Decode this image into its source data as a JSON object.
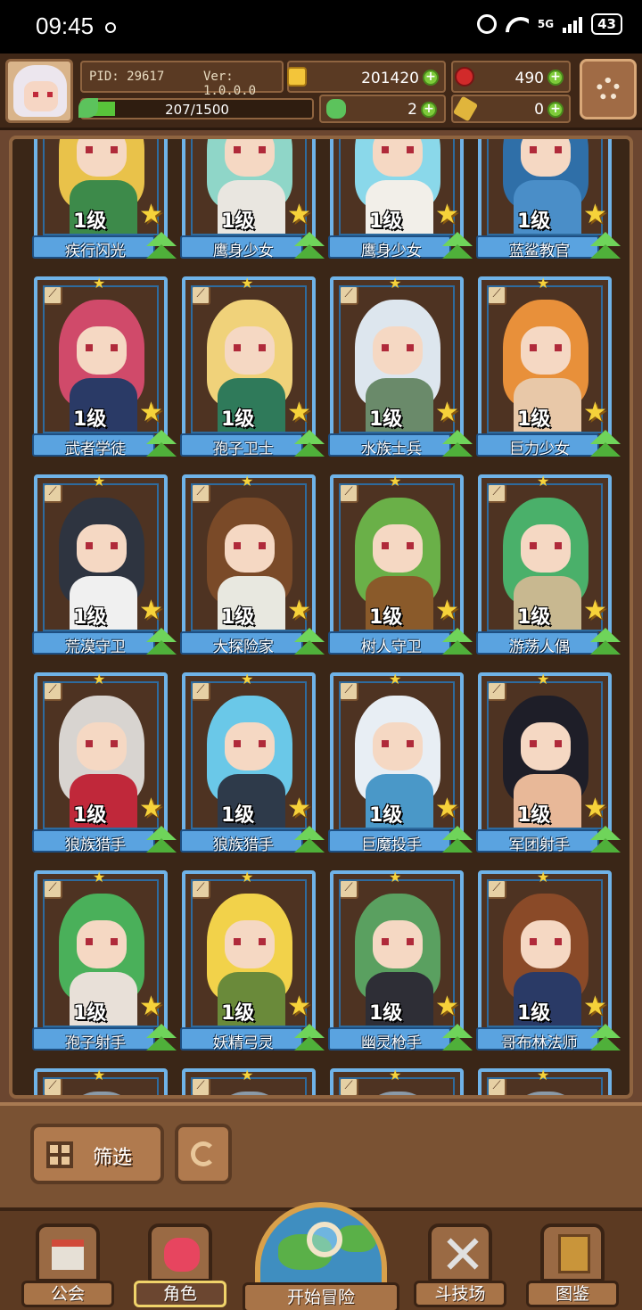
{
  "status_bar": {
    "time": "09:45",
    "network": "5G",
    "battery": "43"
  },
  "player": {
    "pid_label": "PID: 29617",
    "version_label": "Ver: 1.0.0.0",
    "xp_text": "207/1500",
    "xp_fraction": 0.138
  },
  "resources": {
    "gold": "201420",
    "ruby": "490",
    "clover": "2",
    "key": "0"
  },
  "colors": {
    "card_frame": "#6fb3e8",
    "panel_brown": "#6b4630",
    "star": "#f6d23a"
  },
  "cards": [
    {
      "level": "1级",
      "name": "疾行闪光",
      "hair": "#e9c24a",
      "body": "#3d8a4a"
    },
    {
      "level": "1级",
      "name": "鹰身少女",
      "hair": "#8fd6c8",
      "body": "#e9e6e0"
    },
    {
      "level": "1级",
      "name": "鹰身少女",
      "hair": "#8ad8ea",
      "body": "#f2efe9"
    },
    {
      "level": "1级",
      "name": "蓝鲨教官",
      "hair": "#2f6fa8",
      "body": "#4a8ec8"
    },
    {
      "level": "1级",
      "name": "武者学徒",
      "hair": "#d04a6a",
      "body": "#2a3a66"
    },
    {
      "level": "1级",
      "name": "孢子卫士",
      "hair": "#f0d27a",
      "body": "#2f7a5a"
    },
    {
      "level": "1级",
      "name": "水族士兵",
      "hair": "#dde6ee",
      "body": "#6a8a6a"
    },
    {
      "level": "1级",
      "name": "巨力少女",
      "hair": "#e8903a",
      "body": "#e8c8a8"
    },
    {
      "level": "1级",
      "name": "荒漠守卫",
      "hair": "#2e3440",
      "body": "#f0f0f0"
    },
    {
      "level": "1级",
      "name": "大探险家",
      "hair": "#7a4a28",
      "body": "#e8e8e0"
    },
    {
      "level": "1级",
      "name": "树人守卫",
      "hair": "#6ab048",
      "body": "#8a5a2a"
    },
    {
      "level": "1级",
      "name": "游荡人偶",
      "hair": "#4ab06a",
      "body": "#c8b890"
    },
    {
      "level": "1级",
      "name": "狼族猎手",
      "hair": "#d8d4d0",
      "body": "#c0283a"
    },
    {
      "level": "1级",
      "name": "狼族猎手",
      "hair": "#6ac8e8",
      "body": "#2e3a4a"
    },
    {
      "level": "1级",
      "name": "巨魔投手",
      "hair": "#e8eef4",
      "body": "#4a98c8"
    },
    {
      "level": "1级",
      "name": "军团射手",
      "hair": "#1e1e28",
      "body": "#e8b898"
    },
    {
      "level": "1级",
      "name": "孢子射手",
      "hair": "#4ab05a",
      "body": "#e8e0d8"
    },
    {
      "level": "1级",
      "name": "妖精弓灵",
      "hair": "#f2d24a",
      "body": "#6a8a3a"
    },
    {
      "level": "1级",
      "name": "幽灵枪手",
      "hair": "#5aa060",
      "body": "#2e2e36"
    },
    {
      "level": "1级",
      "name": "哥布林法师",
      "hair": "#8a4a28",
      "body": "#2a3a66"
    }
  ],
  "filter": {
    "label": "筛选"
  },
  "nav": {
    "guild": "公会",
    "character": "角色",
    "adventure": "开始冒险",
    "arena": "斗技场",
    "codex": "图鉴"
  }
}
